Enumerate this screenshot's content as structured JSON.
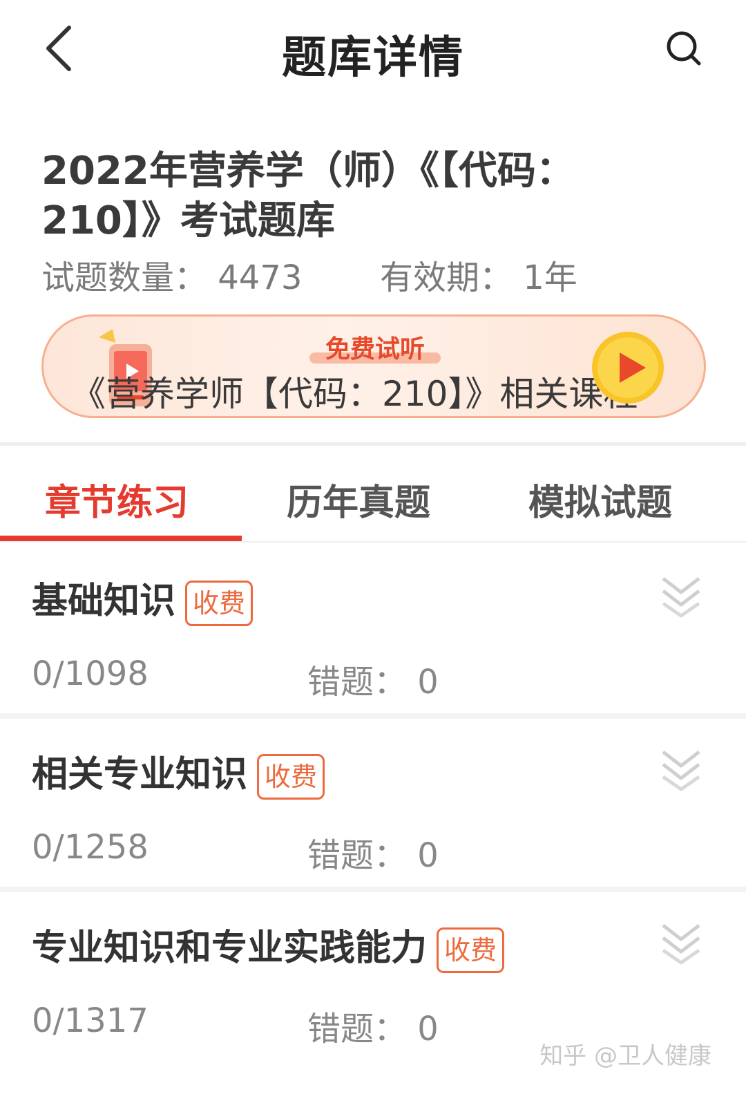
{
  "header": {
    "title": "题库详情"
  },
  "bank": {
    "title_line1": "2022年营养学（师）《【代码：",
    "title_line2": "210】》考试题库",
    "question_count": "试题数量：  4473",
    "validity": "有效期：  1年"
  },
  "promo": {
    "tag": "免费试听",
    "text": "《营养学师【代码：210】》相关课程"
  },
  "tabs": [
    {
      "label": "章节练习",
      "active": true
    },
    {
      "label": "历年真题",
      "active": false
    },
    {
      "label": "模拟试题",
      "active": false
    }
  ],
  "chapters": [
    {
      "name": "基础知识",
      "badge": "收费",
      "progress": "0/1098",
      "wrong": "错题：  0"
    },
    {
      "name": "相关专业知识",
      "badge": "收费",
      "progress": "0/1258",
      "wrong": "错题：  0"
    },
    {
      "name": "专业知识和专业实践能力",
      "badge": "收费",
      "progress": "0/1317",
      "wrong": "错题：  0"
    }
  ],
  "watermark": "知乎 @卫人健康",
  "colors": {
    "accent": "#e53a2e",
    "badge": "#ec6a3d"
  }
}
